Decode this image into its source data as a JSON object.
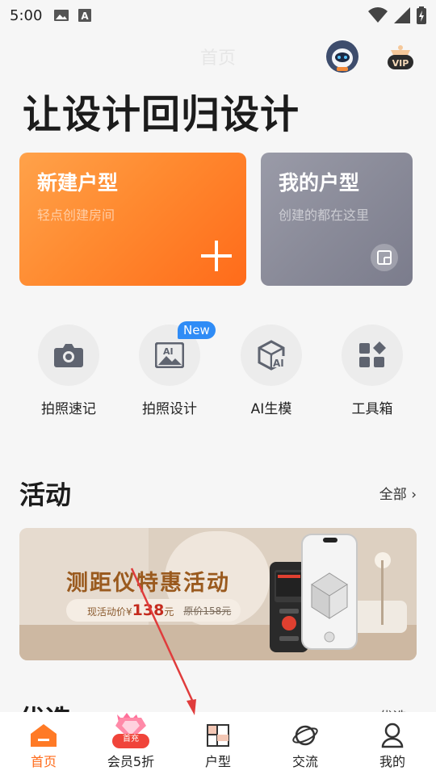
{
  "status": {
    "time": "5:00"
  },
  "header": {
    "title": "首页"
  },
  "hero": {
    "text": "让设计回归设计"
  },
  "cards": {
    "new": {
      "title": "新建户型",
      "subtitle": "轻点创建房间"
    },
    "mine": {
      "title": "我的户型",
      "subtitle": "创建的都在这里"
    }
  },
  "tools": [
    {
      "label": "拍照速记",
      "icon": "camera-icon"
    },
    {
      "label": "拍照设计",
      "icon": "ai-image-icon",
      "badge": "New"
    },
    {
      "label": "AI生模",
      "icon": "ai-cube-icon"
    },
    {
      "label": "工具箱",
      "icon": "grid-tools-icon"
    }
  ],
  "activity": {
    "title": "活动",
    "see_all": "全部 ›",
    "banner": {
      "title": "测距仪特惠活动",
      "price_label": "现活动价¥",
      "price_value": "138",
      "price_unit": "元",
      "original": "原价158元"
    }
  },
  "second_section": {
    "title": "优选",
    "more": "优选 ›"
  },
  "nav": [
    {
      "label": "首页",
      "icon": "home-icon",
      "active": true
    },
    {
      "label": "会员5折",
      "icon": "diamond-icon",
      "badge": "首充"
    },
    {
      "label": "户型",
      "icon": "floorplan-icon"
    },
    {
      "label": "交流",
      "icon": "planet-icon"
    },
    {
      "label": "我的",
      "icon": "user-icon"
    }
  ],
  "colors": {
    "accent": "#ff6b1a",
    "card_new": "#ff8a30",
    "card_mine": "#8a8b99",
    "badge_blue": "#2f8cf6",
    "arrow_red": "#e03c3c"
  }
}
